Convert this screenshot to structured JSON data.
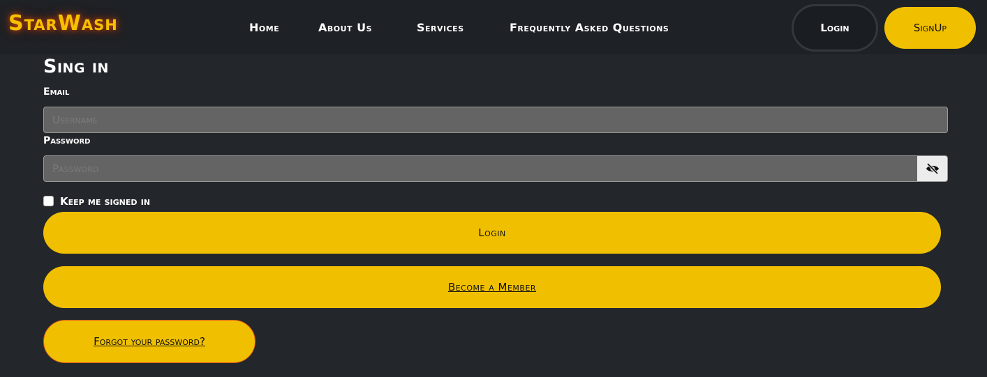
{
  "brand": {
    "name": "StarWash"
  },
  "nav": {
    "links": [
      "Home",
      "About Us",
      "Services",
      "Frequently Asked Questions"
    ],
    "login_label": "Login",
    "signup_label": "SignUp"
  },
  "form": {
    "title": "Sing in",
    "email_label": "Email",
    "email_placeholder": "Username",
    "email_value": "",
    "password_label": "Password",
    "password_placeholder": "Password",
    "password_value": "",
    "password_toggle_icon": "eye-slash-icon",
    "keep_signed_in_label": "Keep me signed in",
    "keep_signed_in_checked": false,
    "login_button": "Login",
    "member_button": "Become a Member",
    "forgot_button": "Forgot your password?"
  },
  "colors": {
    "accent": "#f0c000",
    "background": "#23272b",
    "navbar": "#1e2125",
    "input_bg": "#646464"
  }
}
